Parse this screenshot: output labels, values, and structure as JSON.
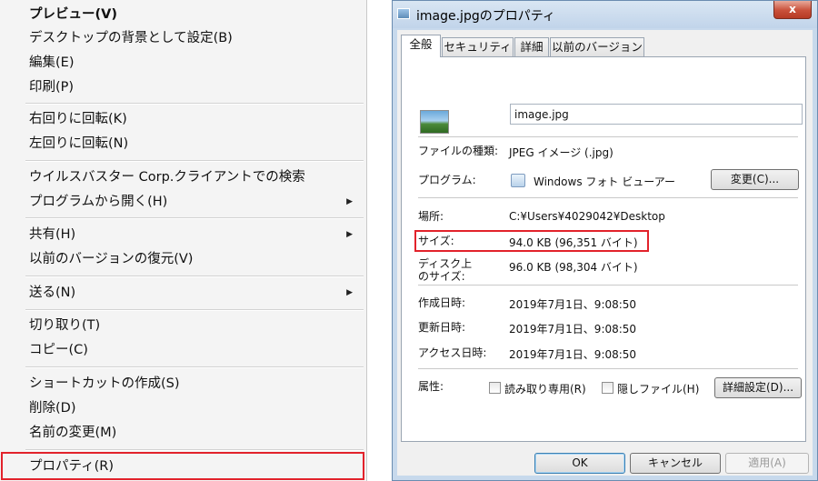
{
  "context_menu": {
    "items": [
      {
        "label": "プレビュー(V)",
        "bold": true
      },
      {
        "label": "デスクトップの背景として設定(B)"
      },
      {
        "label": "編集(E)"
      },
      {
        "label": "印刷(P)"
      },
      {
        "label": "右回りに回転(K)"
      },
      {
        "label": "左回りに回転(N)"
      },
      {
        "label": "ウイルスバスター Corp.クライアントでの検索"
      },
      {
        "label": "プログラムから開く(H)",
        "submenu": true
      },
      {
        "label": "共有(H)",
        "submenu": true
      },
      {
        "label": "以前のバージョンの復元(V)"
      },
      {
        "label": "送る(N)",
        "submenu": true
      },
      {
        "label": "切り取り(T)"
      },
      {
        "label": "コピー(C)"
      },
      {
        "label": "ショートカットの作成(S)"
      },
      {
        "label": "削除(D)"
      },
      {
        "label": "名前の変更(M)"
      },
      {
        "label": "プロパティ(R)",
        "highlighted": true
      }
    ],
    "submenu_arrow": "▶",
    "highlight_color": "#e2222b"
  },
  "dialog": {
    "title": "image.jpgのプロパティ",
    "close_label": "x",
    "tabs": [
      {
        "label": "全般",
        "active": true
      },
      {
        "label": "セキュリティ"
      },
      {
        "label": "詳細"
      },
      {
        "label": "以前のバージョン"
      }
    ],
    "file_name": "image.jpg",
    "rows": {
      "type": {
        "label": "ファイルの種類:",
        "value": "JPEG イメージ (.jpg)"
      },
      "program": {
        "label": "プログラム:",
        "value": "Windows フォト ビューアー",
        "button": "変更(C)..."
      },
      "location": {
        "label": "場所:",
        "value": "C:¥Users¥4029042¥Desktop"
      },
      "size": {
        "label": "サイズ:",
        "value": "94.0 KB (96,351 バイト)"
      },
      "size_on_disk": {
        "label_line1": "ディスク上",
        "label_line2": "のサイズ:",
        "value": "96.0 KB (98,304 バイト)"
      },
      "created": {
        "label": "作成日時:",
        "value": "2019年7月1日、9:08:50"
      },
      "modified": {
        "label": "更新日時:",
        "value": "2019年7月1日、9:08:50"
      },
      "accessed": {
        "label": "アクセス日時:",
        "value": "2019年7月1日、9:08:50"
      },
      "attributes": {
        "label": "属性:",
        "readonly": "読み取り専用(R)",
        "hidden": "隠しファイル(H)",
        "advanced_button": "詳細設定(D)..."
      }
    },
    "buttons": {
      "ok": "OK",
      "cancel": "キャンセル",
      "apply": "適用(A)"
    }
  }
}
